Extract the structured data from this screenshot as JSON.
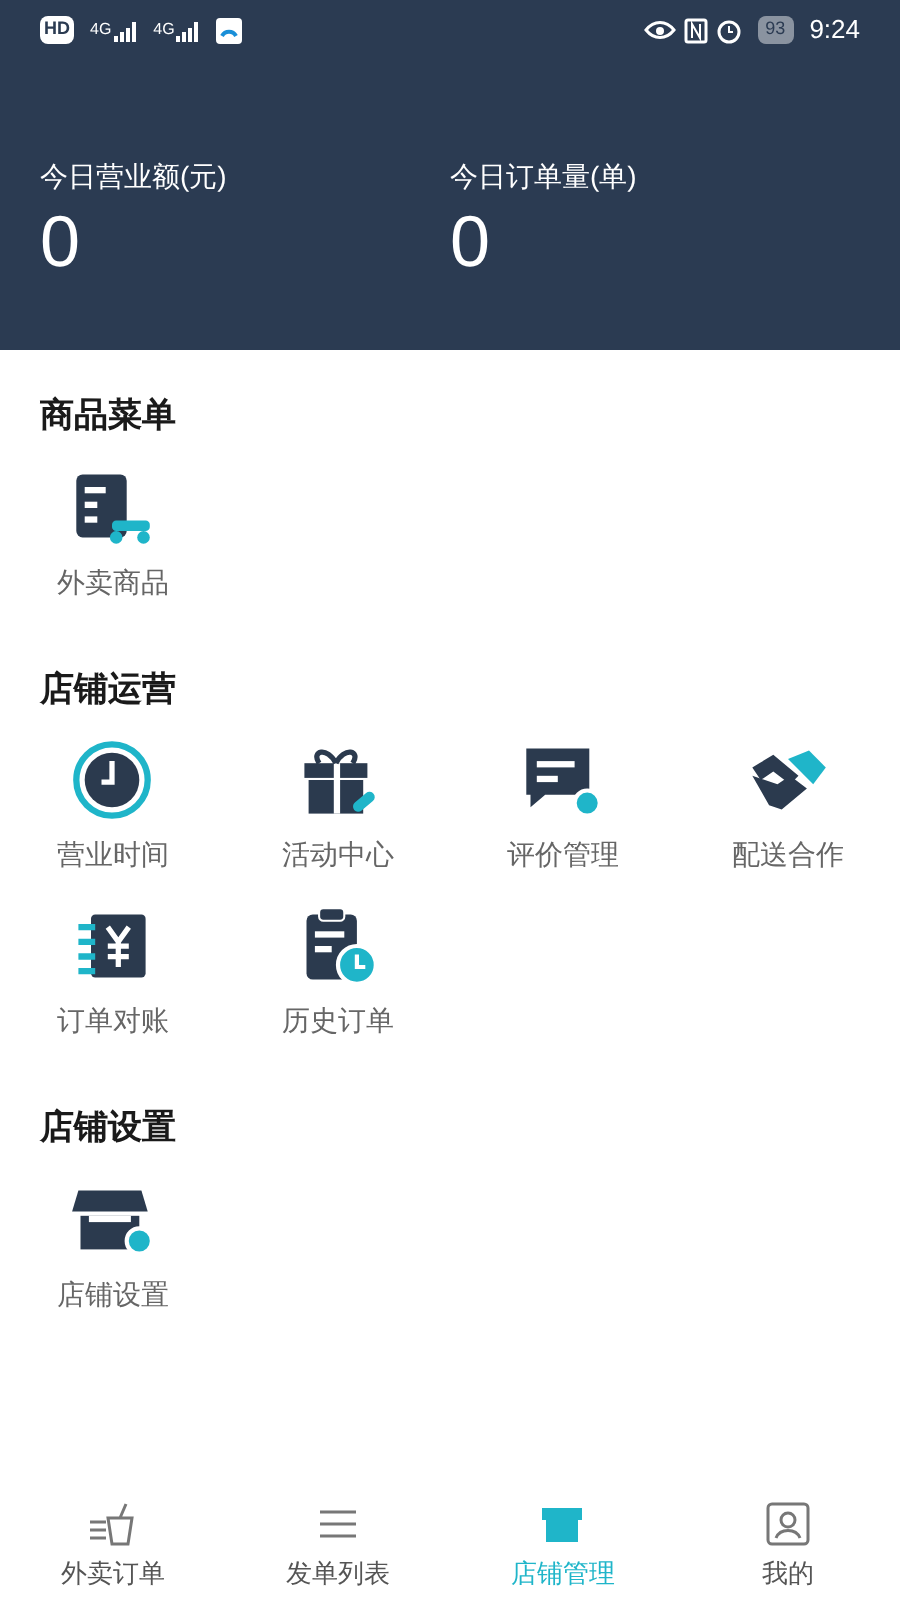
{
  "status_bar": {
    "hd": "HD",
    "networks": [
      "4G",
      "4G"
    ],
    "battery": "93",
    "time": "9:24"
  },
  "stats": [
    {
      "label": "今日营业额(元)",
      "value": "0"
    },
    {
      "label": "今日订单量(单)",
      "value": "0"
    }
  ],
  "sections": [
    {
      "title": "商品菜单",
      "items": [
        {
          "label": "外卖商品"
        }
      ]
    },
    {
      "title": "店铺运营",
      "items": [
        {
          "label": "营业时间"
        },
        {
          "label": "活动中心"
        },
        {
          "label": "评价管理"
        },
        {
          "label": "配送合作"
        },
        {
          "label": "订单对账"
        },
        {
          "label": "历史订单"
        }
      ]
    },
    {
      "title": "店铺设置",
      "items": [
        {
          "label": "店铺设置"
        }
      ]
    }
  ],
  "tabs": [
    {
      "label": "外卖订单",
      "selected": false
    },
    {
      "label": "发单列表",
      "selected": false
    },
    {
      "label": "店铺管理",
      "selected": true
    },
    {
      "label": "我的",
      "selected": false
    }
  ]
}
